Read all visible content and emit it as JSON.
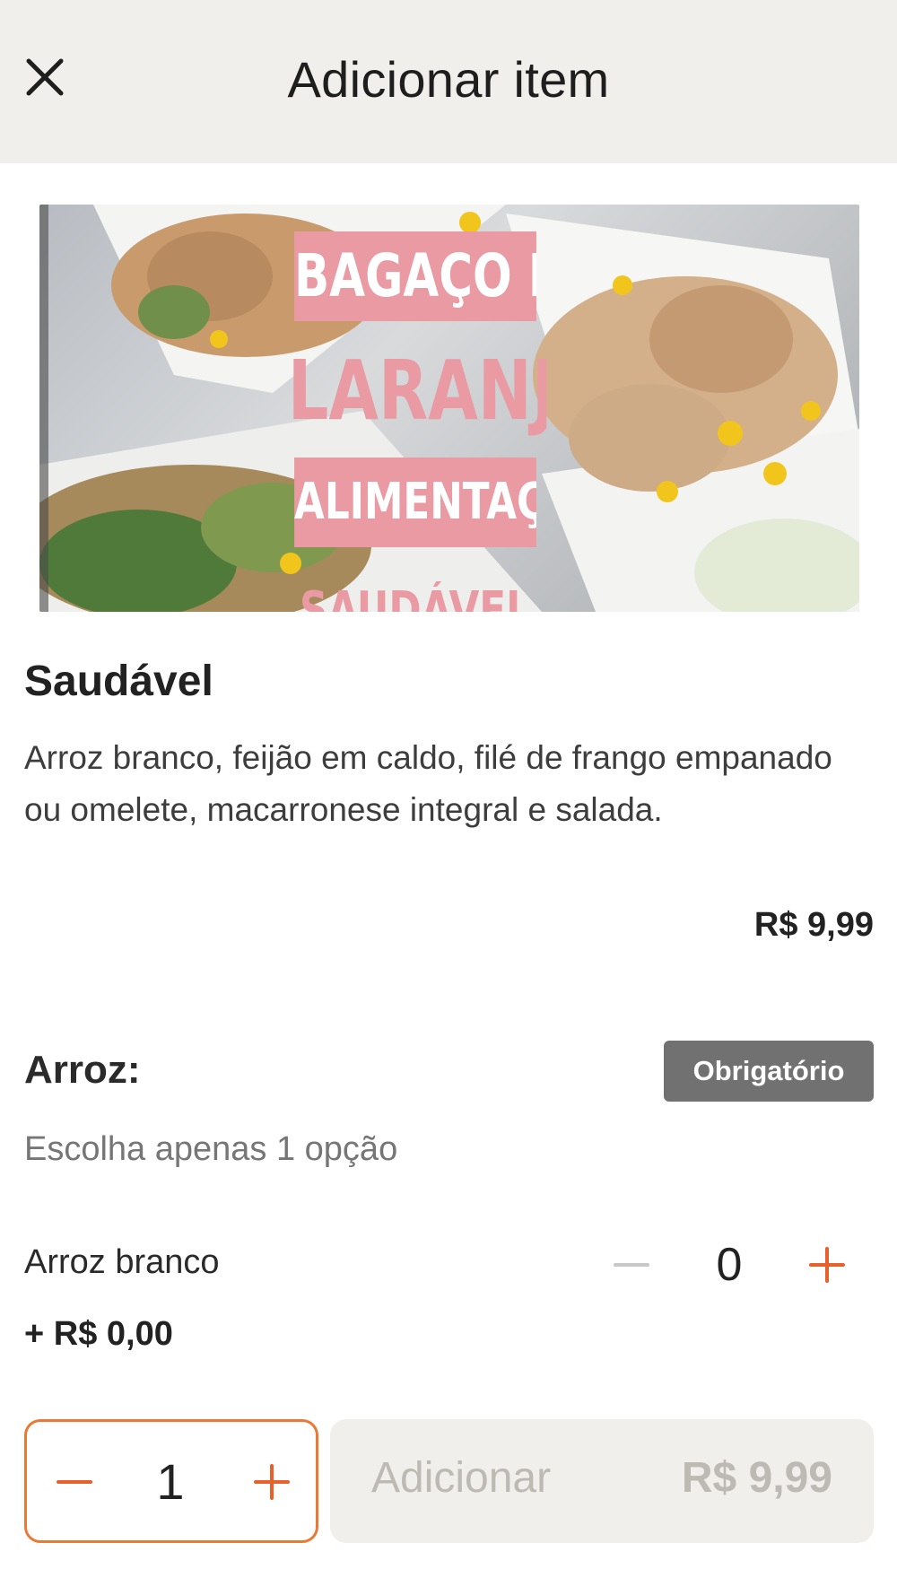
{
  "header": {
    "title": "Adicionar item",
    "close_icon": "close-icon"
  },
  "hero": {
    "banner_line_1": "BAGAÇO DA",
    "banner_line_2": "LARANJA",
    "banner_line_3": "ALIMENTAÇÃO",
    "banner_line_4": "SAUDÁVEL",
    "banner_color": "#e99aa2"
  },
  "item": {
    "name": "Saudável",
    "description": "Arroz branco, feijão em caldo, filé de frango empanado ou omelete, macarronese integral e salada.",
    "price": "R$ 9,99"
  },
  "group": {
    "title": "Arroz:",
    "badge": "Obrigatório",
    "hint": "Escolha apenas 1 opção",
    "options": [
      {
        "name": "Arroz branco",
        "price": "+ R$ 0,00",
        "quantity": "0"
      }
    ]
  },
  "footer": {
    "quantity": "1",
    "add_label": "Adicionar",
    "add_price": "R$ 9,99",
    "accent_color": "#e87a36",
    "disabled_text_color": "#bdbab4"
  }
}
